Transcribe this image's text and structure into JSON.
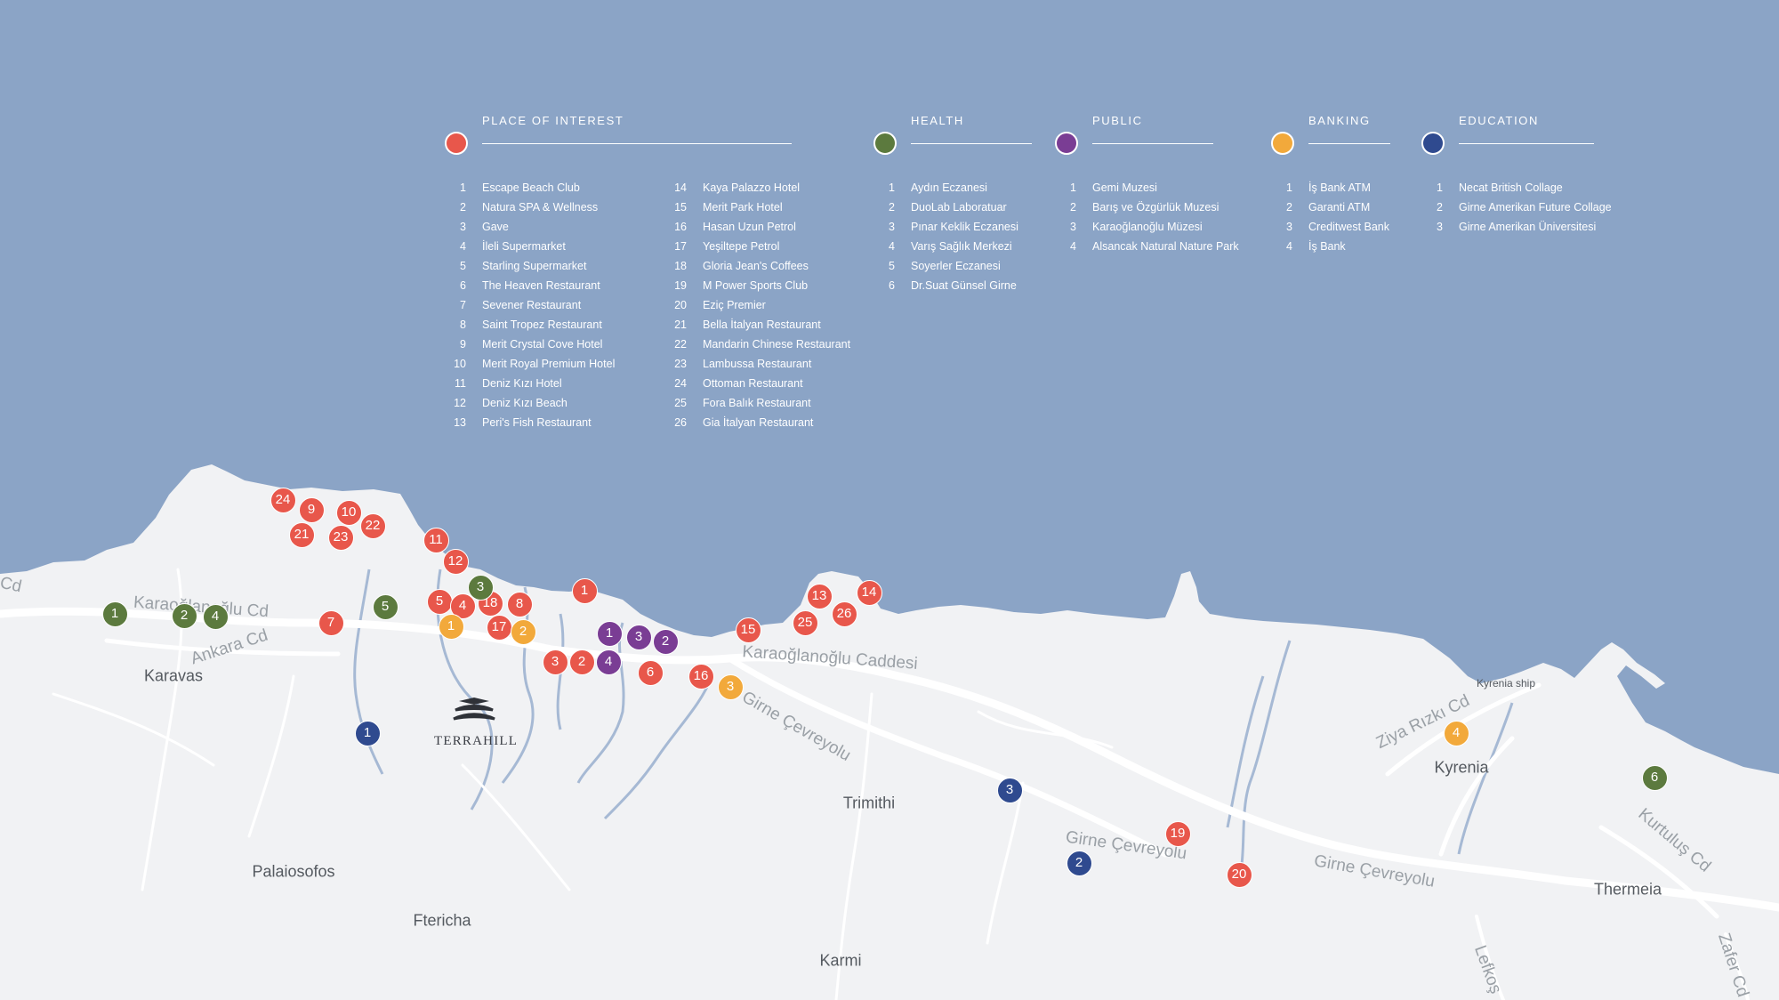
{
  "colors": {
    "sea": "#8ba4c6",
    "land": "#f1f2f4",
    "road": "#ffffff",
    "river": "#a6b9d4",
    "place_of_interest": "#e8574b",
    "health": "#5c7a3e",
    "public": "#7a3d94",
    "banking": "#f2a93b",
    "education": "#2f4a8f"
  },
  "legend": {
    "place_of_interest": {
      "title": "PLACE OF INTEREST",
      "items": [
        {
          "n": "1",
          "name": "Escape Beach Club"
        },
        {
          "n": "2",
          "name": "Natura SPA & Wellness"
        },
        {
          "n": "3",
          "name": "Gave"
        },
        {
          "n": "4",
          "name": "İleli Supermarket"
        },
        {
          "n": "5",
          "name": "Starling Supermarket"
        },
        {
          "n": "6",
          "name": "The Heaven Restaurant"
        },
        {
          "n": "7",
          "name": "Sevener Restaurant"
        },
        {
          "n": "8",
          "name": "Saint Tropez Restaurant"
        },
        {
          "n": "9",
          "name": "Merit Crystal Cove Hotel"
        },
        {
          "n": "10",
          "name": "Merit Royal Premium Hotel"
        },
        {
          "n": "11",
          "name": "Deniz Kızı Hotel"
        },
        {
          "n": "12",
          "name": "Deniz Kızı Beach"
        },
        {
          "n": "13",
          "name": "Peri's Fish Restaurant"
        },
        {
          "n": "14",
          "name": "Kaya Palazzo Hotel"
        },
        {
          "n": "15",
          "name": "Merit Park Hotel"
        },
        {
          "n": "16",
          "name": "Hasan Uzun Petrol"
        },
        {
          "n": "17",
          "name": "Yeşiltepe Petrol"
        },
        {
          "n": "18",
          "name": "Gloria Jean's Coffees"
        },
        {
          "n": "19",
          "name": "M Power Sports Club"
        },
        {
          "n": "20",
          "name": "Eziç Premier"
        },
        {
          "n": "21",
          "name": "Bella İtalyan Restaurant"
        },
        {
          "n": "22",
          "name": "Mandarin Chinese Restaurant"
        },
        {
          "n": "23",
          "name": "Lambussa Restaurant"
        },
        {
          "n": "24",
          "name": "Ottoman Restaurant"
        },
        {
          "n": "25",
          "name": "Fora Balık Restaurant"
        },
        {
          "n": "26",
          "name": "Gia İtalyan Restaurant"
        }
      ]
    },
    "health": {
      "title": "HEALTH",
      "items": [
        {
          "n": "1",
          "name": "Aydın Eczanesi"
        },
        {
          "n": "2",
          "name": "DuoLab Laboratuar"
        },
        {
          "n": "3",
          "name": "Pınar Keklik Eczanesi"
        },
        {
          "n": "4",
          "name": "Varış Sağlık Merkezi"
        },
        {
          "n": "5",
          "name": "Soyerler Eczanesi"
        },
        {
          "n": "6",
          "name": "Dr.Suat Günsel Girne"
        }
      ]
    },
    "public": {
      "title": "PUBLIC",
      "items": [
        {
          "n": "1",
          "name": "Gemi Muzesi"
        },
        {
          "n": "2",
          "name": "Barış ve Özgürlük Muzesi"
        },
        {
          "n": "3",
          "name": "Karaoğlanoğlu Müzesi"
        },
        {
          "n": "4",
          "name": "Alsancak Natural Nature Park"
        }
      ]
    },
    "banking": {
      "title": "BANKING",
      "items": [
        {
          "n": "1",
          "name": "İş Bank ATM"
        },
        {
          "n": "2",
          "name": "Garanti ATM"
        },
        {
          "n": "3",
          "name": "Creditwest Bank"
        },
        {
          "n": "4",
          "name": "İş Bank"
        }
      ]
    },
    "education": {
      "title": "EDUCATION",
      "items": [
        {
          "n": "1",
          "name": "Necat British Collage"
        },
        {
          "n": "2",
          "name": "Girne Amerikan Future Collage"
        },
        {
          "n": "3",
          "name": "Girne Amerikan Üniversitesi"
        }
      ]
    }
  },
  "map": {
    "places": {
      "karavas": "Karavas",
      "palaiosofos": "Palaiosofos",
      "ftericha": "Ftericha",
      "karmi": "Karmi",
      "trimithi": "Trimithi",
      "kyrenia": "Kyrenia",
      "thermeia": "Thermeia",
      "kyrenia_ship": "Kyrenia ship"
    },
    "streets": {
      "cd_left": "Cd",
      "karaoglanoglu_cd": "Karaoğlanoğlu Cd",
      "ankara_cd": "Ankara Cd",
      "karaoglanoglu_caddesi": "Karaoğlanoğlu Caddesi",
      "girne_cevreyolu_1": "Girne Çevreyolu",
      "girne_cevreyolu_2": "Girne Çevreyolu",
      "girne_cevreyolu_3": "Girne Çevreyolu",
      "ziya_rizki_cd": "Ziya Rızkı Cd",
      "kurtulus_cd": "Kurtuluş Cd",
      "lefkos": "Lefkoş",
      "zafer_cd": "Zafer Cd"
    },
    "logo": "TERRAHILL"
  }
}
